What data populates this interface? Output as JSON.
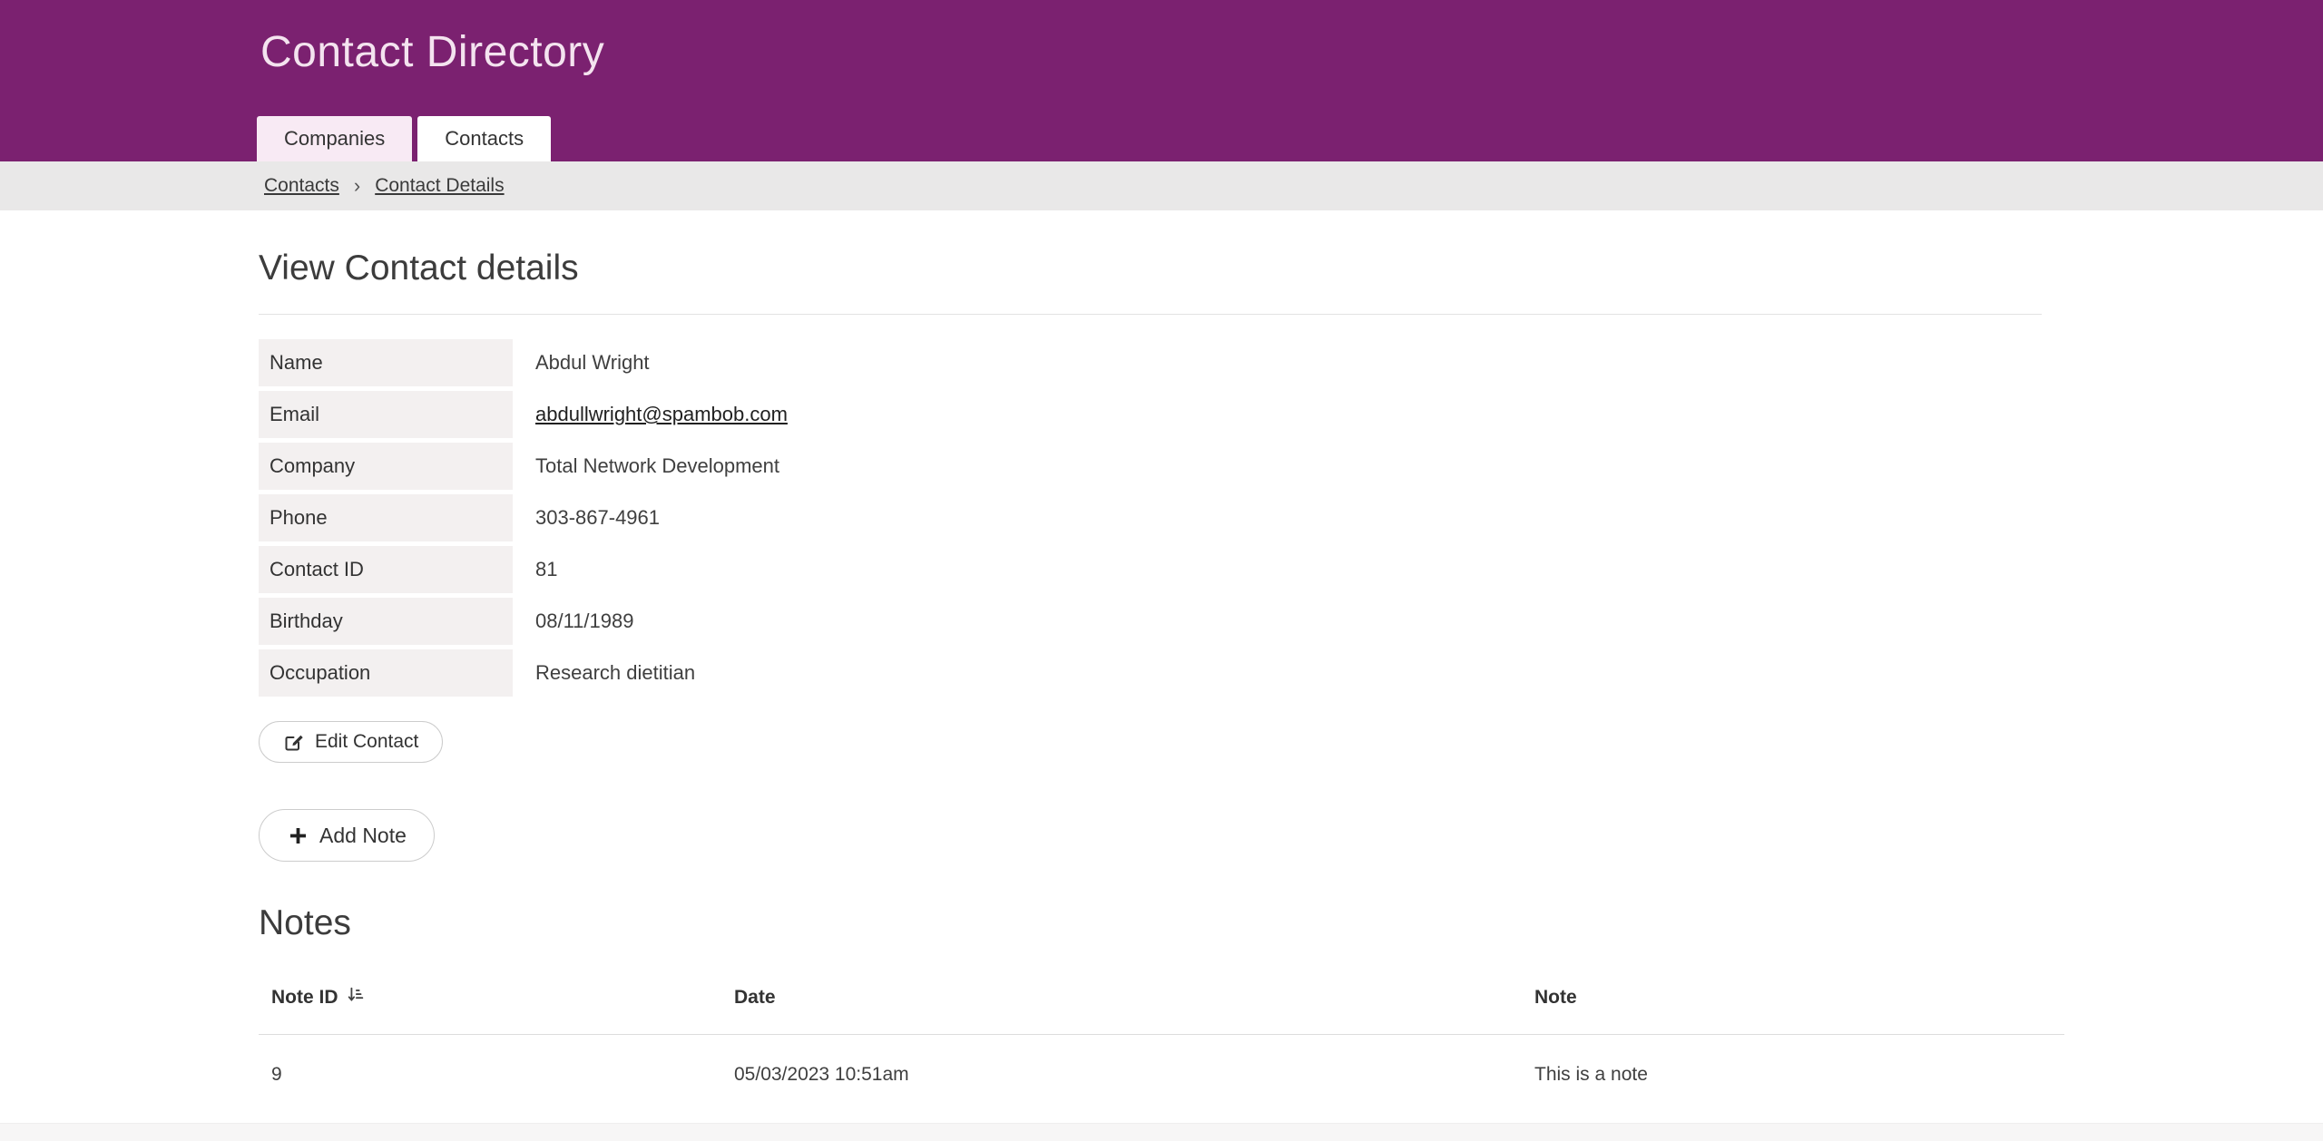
{
  "header": {
    "title": "Contact Directory",
    "tabs": [
      {
        "label": "Companies",
        "active": true
      },
      {
        "label": "Contacts",
        "active": false
      }
    ]
  },
  "breadcrumb": {
    "separator": "›",
    "items": [
      {
        "label": "Contacts"
      },
      {
        "label": "Contact Details"
      }
    ]
  },
  "page": {
    "heading": "View Contact details"
  },
  "contact": {
    "fields": [
      {
        "label": "Name",
        "value": "Abdul Wright"
      },
      {
        "label": "Email",
        "value": "abdullwright@spambob.com"
      },
      {
        "label": "Company",
        "value": "Total Network Development"
      },
      {
        "label": "Phone",
        "value": "303-867-4961"
      },
      {
        "label": "Contact ID",
        "value": "81"
      },
      {
        "label": "Birthday",
        "value": "08/11/1989"
      },
      {
        "label": "Occupation",
        "value": "Research dietitian"
      }
    ],
    "edit_button_label": "Edit Contact"
  },
  "notes": {
    "add_button_label": "Add Note",
    "heading": "Notes",
    "table": {
      "columns": [
        "Note ID",
        "Date",
        "Note"
      ],
      "sorted_by": "Note ID",
      "rows": [
        {
          "note_id": "9",
          "date": "05/03/2023 10:51am",
          "note": "This is a note"
        }
      ]
    }
  },
  "icons": {
    "edit": "pencil-square",
    "add": "plus",
    "sort": "sort-amount-down"
  },
  "colors": {
    "header_bg": "#7b2170",
    "header_title": "#f4e3ef",
    "active_tab_bg": "#f8eaf4",
    "breadcrumb_bg": "#e9e8e8",
    "label_cell_bg": "#f3f0f0"
  }
}
